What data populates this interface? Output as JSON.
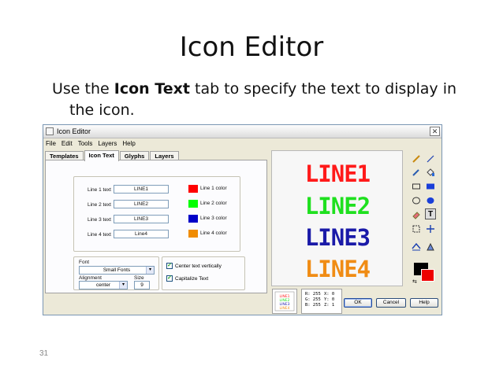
{
  "slide": {
    "title": "Icon Editor",
    "body_pre": "Use the ",
    "body_bold": "Icon Text",
    "body_post": " tab to specify the text to display in",
    "body_line2": "the icon.",
    "page_number": "31"
  },
  "window": {
    "title": "Icon Editor",
    "close": "✕",
    "menu": [
      "File",
      "Edit",
      "Tools",
      "Layers",
      "Help"
    ],
    "tabs": [
      "Templates",
      "Icon Text",
      "Glyphs",
      "Layers"
    ],
    "active_tab": "Icon Text"
  },
  "icon_text": {
    "lines": [
      {
        "label": "Line 1 text",
        "value": "LINE1",
        "color_label": "Line 1 color",
        "color": "#ff0000"
      },
      {
        "label": "Line 2 text",
        "value": "LINE2",
        "color_label": "Line 2 color",
        "color": "#00ff00"
      },
      {
        "label": "Line 3 text",
        "value": "LINE3",
        "color_label": "Line 3 color",
        "color": "#0000c8"
      },
      {
        "label": "Line 4 text",
        "value": "Line4",
        "color_label": "Line 4 color",
        "color": "#f08c00"
      }
    ],
    "font_label": "Font",
    "font_value": "Small Fonts",
    "alignment_label": "Alignment",
    "alignment_value": "center",
    "size_label": "Size",
    "size_value": "9",
    "center_text_label": "Center text vertically",
    "capitalize_label": "Capitalize Text"
  },
  "canvas": {
    "lines": [
      "LINE1",
      "LINE2",
      "LINE3",
      "LINE4"
    ],
    "colors": [
      "#ff1a1a",
      "#1fe01f",
      "#1a1aa8",
      "#f08c14"
    ]
  },
  "tools": [
    "pencil-icon",
    "line-icon",
    "dropper-icon",
    "fill-icon",
    "rectangle-icon",
    "filled-rectangle-icon",
    "ellipse-icon",
    "filled-ellipse-icon",
    "eraser-icon",
    "text-tool-icon",
    "select-icon",
    "move-icon",
    "flip-icon",
    "paint-icon"
  ],
  "text_tool_glyph": "T",
  "readout": {
    "r": "R: 255",
    "x": "X: 0",
    "g": "G: 255",
    "y": "Y: 0",
    "b": "B: 255",
    "z": "Z: 1"
  },
  "preview_lines": [
    "LINE1",
    "LINE2",
    "LINE3",
    "LINE4"
  ],
  "buttons": {
    "ok": "OK",
    "cancel": "Cancel",
    "help": "Help"
  },
  "colors": {
    "foreground": "#000000",
    "background": "#ee0000"
  }
}
